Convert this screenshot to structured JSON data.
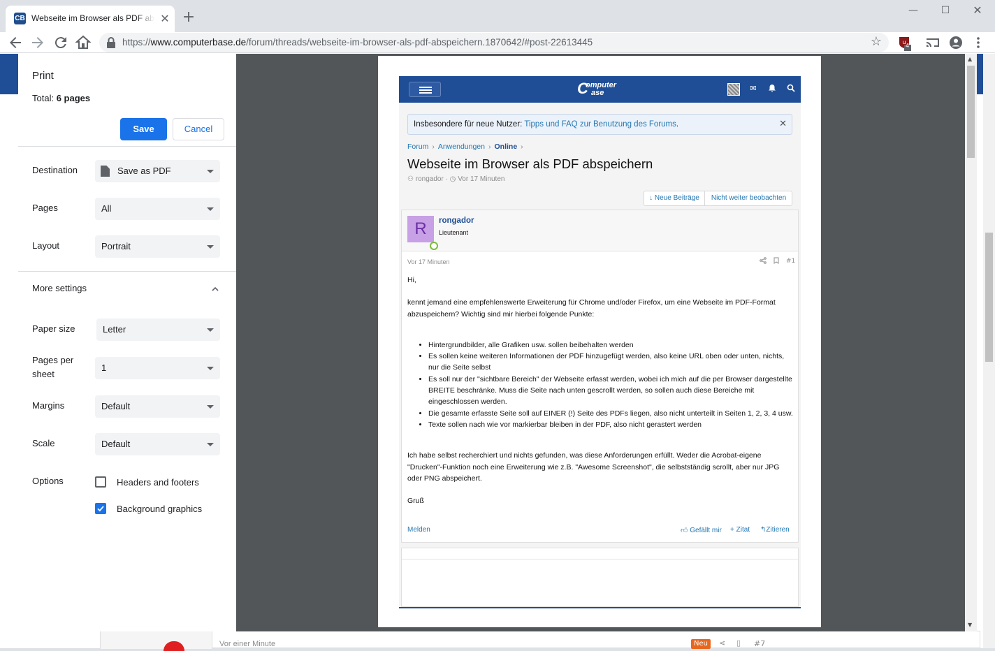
{
  "tab": {
    "favicon_letters": "CB",
    "title": "Webseite im Browser als PDF abspeichern",
    "close": "✕",
    "new_tab": "+"
  },
  "window": {
    "minimize": "—",
    "maximize": "☐",
    "close": "✕"
  },
  "toolbar": {
    "url_scheme": "https://",
    "url_host": "www.computerbase.de",
    "url_path": "/forum/threads/webseite-im-browser-als-pdf-abspeichern.1870642/#post-22613445",
    "extension_badge": "4",
    "icons": [
      "back-icon",
      "forward-icon",
      "reload-icon",
      "home-icon",
      "star-icon",
      "extension-icon",
      "cast-icon",
      "profile-icon",
      "menu-icon"
    ]
  },
  "print": {
    "title": "Print",
    "total_label": "Total:",
    "total_value": "6 pages",
    "save_label": "Save",
    "cancel_label": "Cancel",
    "destination_label": "Destination",
    "destination_value": "Save as PDF",
    "pages_label": "Pages",
    "pages_value": "All",
    "layout_label": "Layout",
    "layout_value": "Portrait",
    "more_settings_label": "More settings",
    "paper_size_label": "Paper size",
    "paper_size_value": "Letter",
    "pages_per_sheet_label_1": "Pages per",
    "pages_per_sheet_label_2": "sheet",
    "pages_per_sheet_value": "1",
    "margins_label": "Margins",
    "margins_value": "Default",
    "scale_label": "Scale",
    "scale_value": "Default",
    "options_label": "Options",
    "headers_footers_label": "Headers and footers",
    "headers_footers_checked": false,
    "background_graphics_label": "Background graphics",
    "background_graphics_checked": true
  },
  "forum": {
    "logo_top": "omputer",
    "logo_bottom": "ase",
    "logo_c": "C",
    "notice_prefix": "Insbesondere für neue Nutzer: ",
    "notice_link": "Tipps und FAQ zur Benutzung des Forums",
    "notice_suffix": ".",
    "notice_close": "✕",
    "breadcrumb": [
      "Forum",
      "Anwendungen",
      "Online"
    ],
    "breadcrumb_sep": "›",
    "thread_title": "Webseite im Browser als PDF abspeichern",
    "thread_author": "rongador",
    "thread_time": "Vor 17 Minuten",
    "btn_new_posts": "↓ Neue Beiträge",
    "btn_unwatch": "Nicht weiter beobachten",
    "post": {
      "avatar_letter": "R",
      "username": "rongador",
      "rank": "Lieutenant",
      "time": "Vor 17 Minuten",
      "number": "#1",
      "greeting": "Hi,",
      "para1": "kennt jemand eine empfehlenswerte Erweiterung für Chrome und/oder Firefox, um eine Webseite im PDF-Format abzuspeichern? Wichtig sind mir hierbei folgende Punkte:",
      "bullets": [
        "Hintergrundbilder, alle Grafiken usw. sollen beibehalten werden",
        "Es sollen keine weiteren Informationen der PDF hinzugefügt werden, also keine URL oben oder unten, nichts, nur die Seite selbst",
        "Es soll nur der \"sichtbare Bereich\" der Webseite erfasst werden, wobei ich mich auf die per Browser dargestellte BREITE beschränke. Muss die Seite nach unten gescrollt werden, so sollen auch diese Bereiche mit eingeschlossen werden.",
        "Die gesamte erfasste Seite soll auf EINER (!) Seite des PDFs liegen, also nicht unterteilt in Seiten 1, 2, 3, 4 usw.",
        "Texte sollen nach wie vor markierbar bleiben in der PDF, also nicht gerastert werden"
      ],
      "para2": "Ich habe selbst recherchiert und nichts gefunden, was diese Anforderungen erfüllt. Weder die Acrobat-eigene \"Drucken\"-Funktion noch eine Erweiterung wie z.B. \"Awesome Screenshot\", die selbstständig scrollt, aber nur JPG oder PNG abspeichert.",
      "closing": "Gruß",
      "report": "Melden",
      "like": "Gefällt mir",
      "zitat": "+ Zitat",
      "quote": "Zitieren"
    }
  },
  "background_page": {
    "time": "Vor einer Minute",
    "badge": "Neu",
    "number": "#7"
  }
}
